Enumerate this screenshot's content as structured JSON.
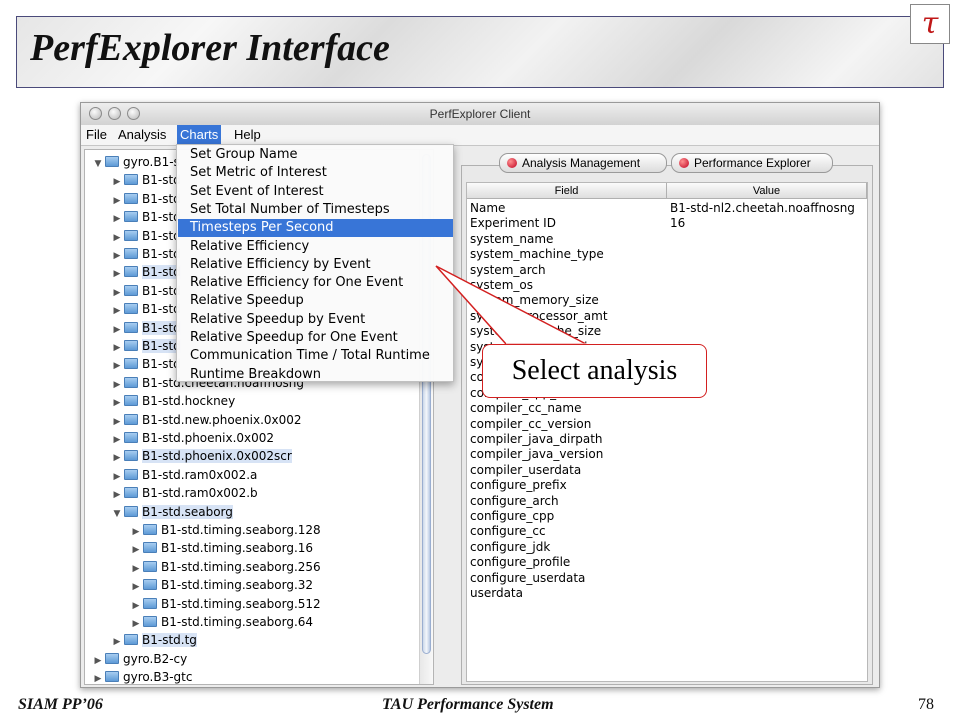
{
  "slide": {
    "title": "PerfExplorer Interface",
    "logo_glyph": "τ",
    "footer_left": "SIAM PP’06",
    "footer_center": "TAU Performance System",
    "page_number": "78"
  },
  "window": {
    "title": "PerfExplorer Client",
    "menus": [
      {
        "label": "File"
      },
      {
        "label": "Analysis"
      },
      {
        "label": "Charts"
      },
      {
        "label": "Help"
      }
    ]
  },
  "dropdown": {
    "items": [
      "Set Group Name",
      "Set Metric of Interest",
      "Set Event of Interest",
      "Set Total Number of Timesteps",
      "Timesteps Per Second",
      "Relative Efficiency",
      "Relative Efficiency by Event",
      "Relative Efficiency for One Event",
      "Relative Speedup",
      "Relative Speedup by Event",
      "Relative Speedup for One Event",
      "Communication Time / Total Runtime",
      "Runtime Breakdown"
    ],
    "active_index": 4
  },
  "tree": {
    "items": [
      {
        "label": "gyro.B1-s",
        "expanded": true,
        "depth": 0,
        "selected": false
      },
      {
        "label": "B1-std",
        "expanded": false,
        "depth": 1,
        "selected": false
      },
      {
        "label": "B1-std",
        "expanded": false,
        "depth": 1,
        "selected": false
      },
      {
        "label": "B1-std",
        "expanded": false,
        "depth": 1,
        "selected": false
      },
      {
        "label": "B1-std",
        "expanded": false,
        "depth": 1,
        "selected": false
      },
      {
        "label": "B1-std",
        "expanded": false,
        "depth": 1,
        "selected": false
      },
      {
        "label": "B1-std",
        "expanded": false,
        "depth": 1,
        "selected": true
      },
      {
        "label": "B1-std",
        "expanded": false,
        "depth": 1,
        "selected": false
      },
      {
        "label": "B1-std",
        "expanded": false,
        "depth": 1,
        "selected": false
      },
      {
        "label": "B1-std",
        "expanded": false,
        "depth": 1,
        "selected": true
      },
      {
        "label": "B1-std",
        "expanded": false,
        "depth": 1,
        "selected": true
      },
      {
        "label": "B1-std",
        "expanded": false,
        "depth": 1,
        "selected": false
      },
      {
        "label": "B1-std.cheetah.noaffnosng",
        "expanded": false,
        "depth": 1,
        "selected": false
      },
      {
        "label": "B1-std.hockney",
        "expanded": false,
        "depth": 1,
        "selected": false
      },
      {
        "label": "B1-std.new.phoenix.0x002",
        "expanded": false,
        "depth": 1,
        "selected": false
      },
      {
        "label": "B1-std.phoenix.0x002",
        "expanded": false,
        "depth": 1,
        "selected": false
      },
      {
        "label": "B1-std.phoenix.0x002scr",
        "expanded": false,
        "depth": 1,
        "selected": true
      },
      {
        "label": "B1-std.ram0x002.a",
        "expanded": false,
        "depth": 1,
        "selected": false
      },
      {
        "label": "B1-std.ram0x002.b",
        "expanded": false,
        "depth": 1,
        "selected": false
      },
      {
        "label": "B1-std.seaborg",
        "expanded": true,
        "depth": 1,
        "selected": true
      },
      {
        "label": "B1-std.timing.seaborg.128",
        "expanded": false,
        "depth": 2,
        "selected": false
      },
      {
        "label": "B1-std.timing.seaborg.16",
        "expanded": false,
        "depth": 2,
        "selected": false
      },
      {
        "label": "B1-std.timing.seaborg.256",
        "expanded": false,
        "depth": 2,
        "selected": false
      },
      {
        "label": "B1-std.timing.seaborg.32",
        "expanded": false,
        "depth": 2,
        "selected": false
      },
      {
        "label": "B1-std.timing.seaborg.512",
        "expanded": false,
        "depth": 2,
        "selected": false
      },
      {
        "label": "B1-std.timing.seaborg.64",
        "expanded": false,
        "depth": 2,
        "selected": false
      },
      {
        "label": "B1-std.tg",
        "expanded": false,
        "depth": 1,
        "selected": true
      },
      {
        "label": "gyro.B2-cy",
        "expanded": false,
        "depth": 0,
        "selected": false
      },
      {
        "label": "gyro.B3-gtc",
        "expanded": false,
        "depth": 0,
        "selected": false
      }
    ]
  },
  "tabs": [
    {
      "label": "Analysis Management"
    },
    {
      "label": "Performance Explorer"
    }
  ],
  "table": {
    "headers": [
      "Field",
      "Value"
    ],
    "rows": [
      [
        "Name",
        "B1-std-nl2.cheetah.noaffnosng"
      ],
      [
        "Experiment ID",
        "16"
      ],
      [
        "system_name",
        ""
      ],
      [
        "system_machine_type",
        ""
      ],
      [
        "system_arch",
        ""
      ],
      [
        "system_os",
        ""
      ],
      [
        "system_memory_size",
        ""
      ],
      [
        "system_processor_amt",
        ""
      ],
      [
        "system_l1_cache_size",
        ""
      ],
      [
        "system_l2_cache_size",
        ""
      ],
      [
        "system_userdata",
        ""
      ],
      [
        "compiler_cpp_name",
        ""
      ],
      [
        "compiler_cpp_version",
        ""
      ],
      [
        "compiler_cc_name",
        ""
      ],
      [
        "compiler_cc_version",
        ""
      ],
      [
        "compiler_java_dirpath",
        ""
      ],
      [
        "compiler_java_version",
        ""
      ],
      [
        "compiler_userdata",
        ""
      ],
      [
        "configure_prefix",
        ""
      ],
      [
        "configure_arch",
        ""
      ],
      [
        "configure_cpp",
        ""
      ],
      [
        "configure_cc",
        ""
      ],
      [
        "configure_jdk",
        ""
      ],
      [
        "configure_profile",
        ""
      ],
      [
        "configure_userdata",
        ""
      ],
      [
        "userdata",
        ""
      ]
    ]
  },
  "callout": {
    "text": "Select analysis"
  },
  "colors": {
    "highlight": "#3875d7",
    "callout_border": "#d32020",
    "logo": "#c01818"
  }
}
